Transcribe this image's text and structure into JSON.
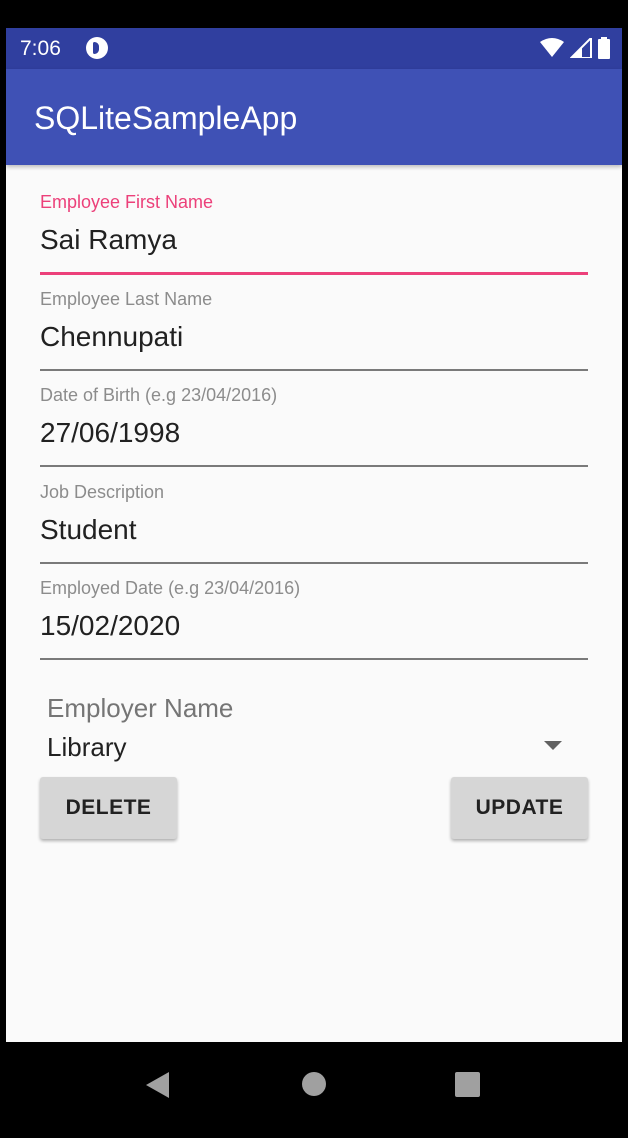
{
  "status_bar": {
    "time": "7:06",
    "icons": [
      "app-notification-icon",
      "wifi-icon",
      "signal-icon",
      "battery-icon"
    ]
  },
  "app_bar": {
    "title": "SQLiteSampleApp",
    "color": "#3f51b5"
  },
  "form": {
    "first_name": {
      "label": "Employee First Name",
      "value": "Sai Ramya",
      "focused": true
    },
    "last_name": {
      "label": "Employee Last Name",
      "value": "Chennupati"
    },
    "dob": {
      "label": "Date of Birth (e.g 23/04/2016)",
      "value": "27/06/1998"
    },
    "job": {
      "label": "Job Description",
      "value": "Student"
    },
    "employed_date": {
      "label": "Employed Date (e.g 23/04/2016)",
      "value": "15/02/2020"
    },
    "employer": {
      "label": "Employer Name",
      "selected": "Library"
    }
  },
  "buttons": {
    "delete": "DELETE",
    "update": "UPDATE"
  },
  "colors": {
    "accent": "#ec407a",
    "primary": "#3f51b5",
    "primary_dark": "#303f9f"
  },
  "nav_bar": {
    "icons": [
      "back-icon",
      "home-icon",
      "recents-icon"
    ]
  }
}
